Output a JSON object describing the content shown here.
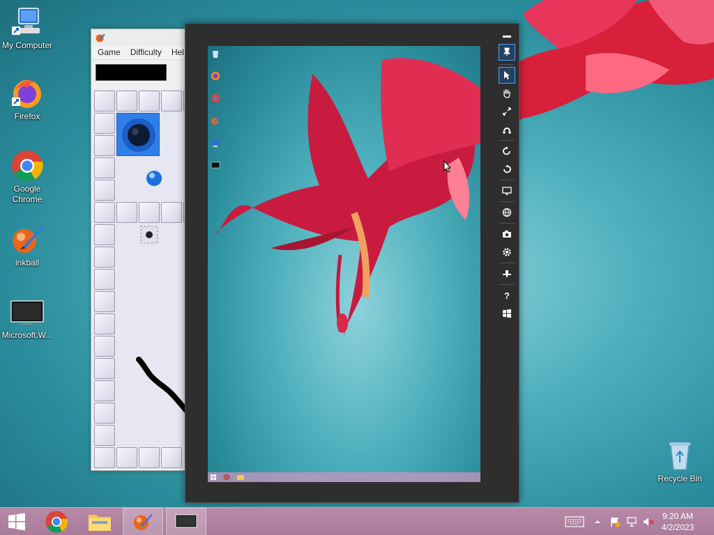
{
  "desktop": {
    "icons": [
      {
        "label": "My Computer",
        "icon": "computer-icon"
      },
      {
        "label": "Firefox",
        "icon": "firefox-icon"
      },
      {
        "label": "Google Chrome",
        "icon": "chrome-icon"
      },
      {
        "label": "inkball",
        "icon": "inkball-icon"
      },
      {
        "label": "Microsoft.W...",
        "icon": "monitor-icon"
      },
      {
        "label": "Recycle Bin",
        "icon": "recycle-bin-icon"
      }
    ]
  },
  "inkball": {
    "menu": [
      "Game",
      "Difficulty",
      "Hel"
    ]
  },
  "viewer": {
    "sidebar_tools": [
      "minimize-icon",
      "pin-icon",
      "pointer-icon",
      "hand-icon",
      "expand-icon",
      "reconnect-icon",
      "rotate-right-icon",
      "rotate-left-icon",
      "display-icon",
      "globe-icon",
      "camera-icon",
      "settings-icon",
      "keyboard-icon",
      "help-icon",
      "windows-icon"
    ],
    "help_glyph": "?"
  },
  "taskbar": {
    "time": "9:20 AM",
    "date": "4/2/2023",
    "accent": "#b88aa8"
  }
}
